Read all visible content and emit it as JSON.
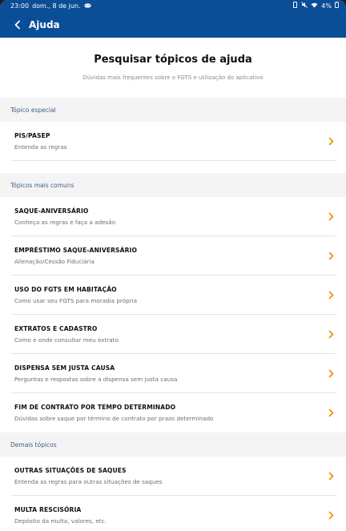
{
  "status_bar": {
    "time": "23:00",
    "date": "dom., 8 de jun.",
    "battery": "4%"
  },
  "app_bar": {
    "title": "Ajuda",
    "back_icon": "chevron-left-icon"
  },
  "page": {
    "title": "Pesquisar tópicos de ajuda",
    "subtitle": "Dúvidas mais frequentes sobre o FGTS e utilização do aplicativo"
  },
  "colors": {
    "primary": "#0a4e98",
    "chevron": "#f28c00",
    "section_bg": "#f4f4f4",
    "section_text": "#3f5f86"
  },
  "sections": [
    {
      "header": "Tópico especial",
      "items": [
        {
          "title": "PIS/PASEP",
          "subtitle": "Entenda as regras"
        }
      ]
    },
    {
      "header": "Tópicos mais comuns",
      "items": [
        {
          "title": "SAQUE-ANIVERSÁRIO",
          "subtitle": "Conheça as regras e faça a adesão"
        },
        {
          "title": "EMPRÉSTIMO SAQUE-ANIVERSÁRIO",
          "subtitle": "Alienação/Cessão Fiduciária"
        },
        {
          "title": "USO DO FGTS EM HABITAÇÃO",
          "subtitle": "Como usar seu FGTS para moradia própria"
        },
        {
          "title": "EXTRATOS E CADASTRO",
          "subtitle": "Como e onde consultar meu extrato"
        },
        {
          "title": "DISPENSA SEM JUSTA CAUSA",
          "subtitle": "Perguntas e respostas sobre a dispensa sem justa causa"
        },
        {
          "title": "FIM DE CONTRATO POR TEMPO DETERMINADO",
          "subtitle": "Dúvidas sobre saque por término de contrato por prazo determinado"
        }
      ]
    },
    {
      "header": "Demais tópicos",
      "items": [
        {
          "title": "OUTRAS SITUAÇÕES DE SAQUES",
          "subtitle": "Entenda as regras para outras situações de saques"
        },
        {
          "title": "MULTA RESCISÓRIA",
          "subtitle": "Depósito da multa, valores, etc."
        }
      ]
    }
  ]
}
